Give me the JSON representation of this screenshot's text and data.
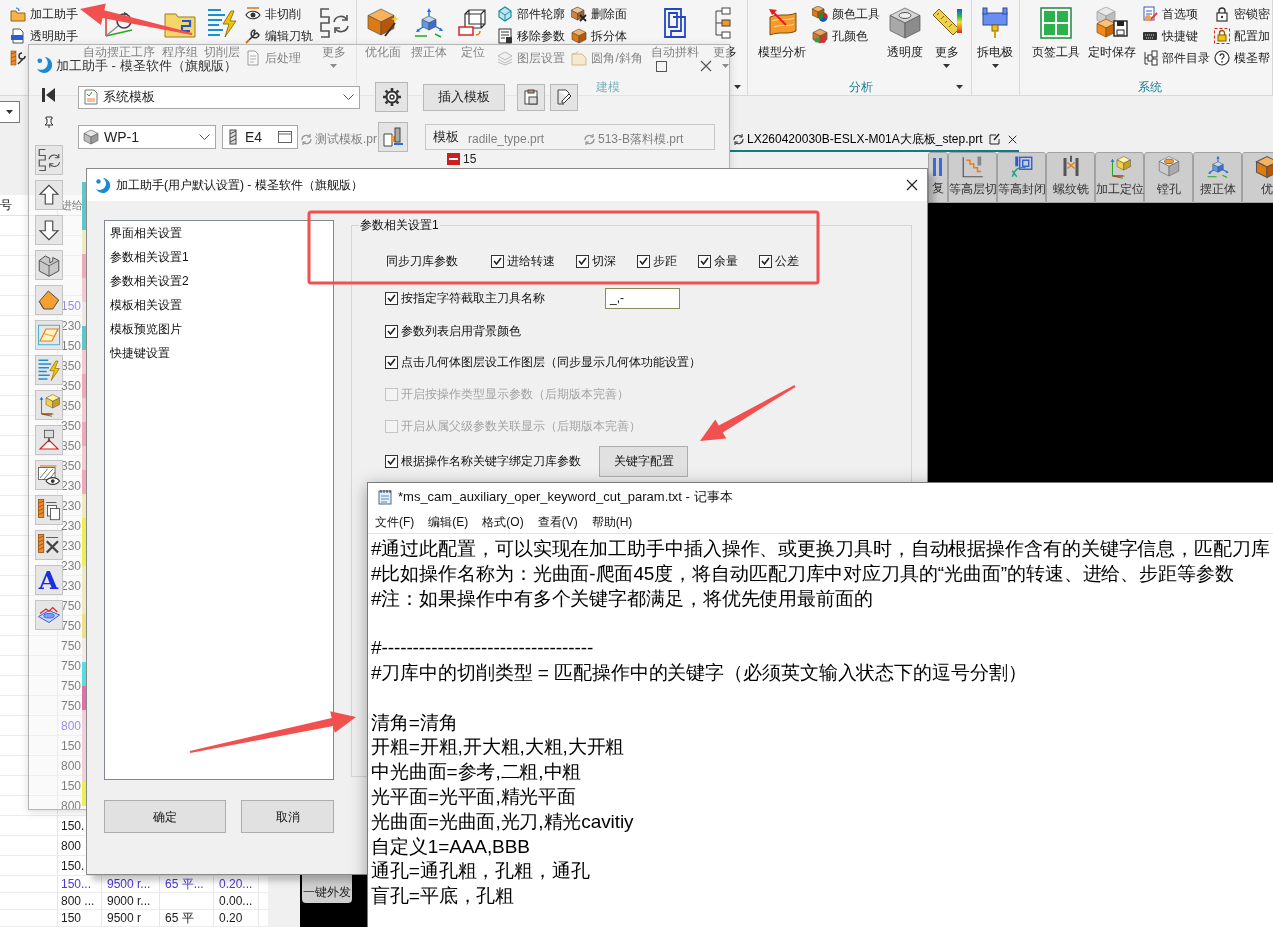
{
  "ribbon": {
    "groups": [
      {
        "launcher": false,
        "columns": [
          {
            "kind": "stack",
            "items": [
              {
                "kind": "labeled",
                "label": "加工助手"
              },
              {
                "kind": "labeled",
                "label": "透明助手"
              },
              {
                "kind": "icon"
              }
            ]
          },
          {
            "kind": "large",
            "label": "自动摆正工序",
            "caret": false
          },
          {
            "kind": "large",
            "label": "程序组",
            "caret": false
          },
          {
            "kind": "large",
            "label": "切削层",
            "caret": false
          },
          {
            "kind": "stack",
            "items": [
              {
                "kind": "labeled",
                "label": "非切削"
              },
              {
                "kind": "labeled",
                "label": "编辑刀轨"
              },
              {
                "kind": "labeled",
                "label": "后处理"
              }
            ]
          },
          {
            "kind": "large",
            "label": "更多",
            "caret": true
          }
        ]
      },
      {
        "label": "建模",
        "launcher": true,
        "columns": [
          {
            "kind": "large",
            "label": "优化面",
            "caret": false
          },
          {
            "kind": "large",
            "label": "摆正体",
            "caret": false
          },
          {
            "kind": "large",
            "label": "定位",
            "caret": false
          },
          {
            "kind": "stack",
            "items": [
              {
                "kind": "labeled",
                "label": "部件轮廓"
              },
              {
                "kind": "labeled",
                "label": "移除参数"
              },
              {
                "kind": "labeled",
                "label": "图层设置"
              }
            ]
          },
          {
            "kind": "stack",
            "items": [
              {
                "kind": "labeled",
                "label": "删除面"
              },
              {
                "kind": "labeled",
                "label": "拆分体"
              },
              {
                "kind": "labeled",
                "label": "圆角/斜角"
              }
            ]
          },
          {
            "kind": "large",
            "label": "自动拼料",
            "caret": false
          },
          {
            "kind": "large",
            "label": "更多",
            "caret": true
          }
        ]
      },
      {
        "label": "分析",
        "launcher": true,
        "columns": [
          {
            "kind": "large",
            "label": "模型分析",
            "caret": false
          },
          {
            "kind": "stack",
            "items": [
              {
                "kind": "labeled",
                "label": "颜色工具"
              },
              {
                "kind": "labeled",
                "label": "孔颜色"
              }
            ]
          },
          {
            "kind": "large",
            "label": "透明度",
            "caret": false
          },
          {
            "kind": "large",
            "label": "更多",
            "caret": true
          }
        ]
      },
      {
        "launcher": false,
        "columns": [
          {
            "kind": "large",
            "label": "拆电极",
            "caret": true
          }
        ]
      },
      {
        "label": "系统",
        "launcher": false,
        "columns": [
          {
            "kind": "large",
            "label": "页签工具",
            "caret": false
          },
          {
            "kind": "large",
            "label": "定时保存",
            "caret": false
          },
          {
            "kind": "stack",
            "items": [
              {
                "kind": "labeled",
                "label": "首选项"
              },
              {
                "kind": "labeled",
                "label": "快捷键"
              },
              {
                "kind": "labeled",
                "label": "部件目录"
              }
            ]
          },
          {
            "kind": "stack",
            "items": [
              {
                "kind": "labeled",
                "label": "密锁密"
              },
              {
                "kind": "labeled",
                "label": "配置加"
              },
              {
                "kind": "labeled",
                "label": "模圣帮"
              }
            ]
          }
        ]
      }
    ]
  },
  "part_tabs": [
    {
      "label": "测试模板.pr",
      "selected": false
    },
    {
      "label": "radile_type.prt",
      "selected": false
    },
    {
      "label": "513-B落料模.prt",
      "selected": false
    },
    {
      "label": "LX260420030B-ESLX-M01A大底板_step.prt",
      "selected": true
    }
  ],
  "operation_toolbar": [
    {
      "label": "复"
    },
    {
      "label": "等高层切"
    },
    {
      "label": "等高封闭"
    },
    {
      "label": "螺纹铣"
    },
    {
      "label": "加工定位"
    },
    {
      "label": "镗孔"
    },
    {
      "label": "摆正体"
    },
    {
      "label": "优"
    }
  ],
  "operation_table": {
    "header": {
      "column_1": "号",
      "column_2": "进给"
    },
    "rows": [
      {
        "highlighted": true,
        "column_2": "150"
      },
      {
        "highlighted": false,
        "column_2": "230"
      },
      {
        "highlighted": false,
        "column_2": "150"
      },
      {
        "highlighted": false,
        "column_2": "350"
      },
      {
        "highlighted": false,
        "column_2": "350"
      },
      {
        "highlighted": false,
        "column_2": "350"
      },
      {
        "highlighted": false,
        "column_2": "350"
      },
      {
        "highlighted": false,
        "column_2": "350"
      },
      {
        "highlighted": false,
        "column_2": "350"
      },
      {
        "highlighted": false,
        "column_2": "230"
      },
      {
        "highlighted": false,
        "column_2": "230"
      },
      {
        "highlighted": false,
        "column_2": "230"
      },
      {
        "highlighted": false,
        "column_2": "230"
      },
      {
        "highlighted": false,
        "column_2": "230"
      },
      {
        "highlighted": false,
        "column_2": "230"
      },
      {
        "highlighted": false,
        "column_2": "750"
      },
      {
        "highlighted": false,
        "column_2": "750"
      },
      {
        "highlighted": false,
        "column_2": "750"
      },
      {
        "highlighted": false,
        "column_2": "750"
      },
      {
        "highlighted": false,
        "column_2": "750"
      },
      {
        "highlighted": false,
        "column_2": "750"
      },
      {
        "highlighted": true,
        "column_2": "800"
      },
      {
        "highlighted": false,
        "column_2": "150"
      },
      {
        "highlighted": false,
        "column_2": "800"
      },
      {
        "highlighted": false,
        "column_2": "150"
      },
      {
        "highlighted": false,
        "column_2": "800"
      },
      {
        "highlighted": false,
        "column_2": "150."
      },
      {
        "highlighted": false,
        "column_2": "800"
      },
      {
        "highlighted": false,
        "column_2": "150."
      },
      {
        "highlighted": true,
        "column_2": "150...",
        "column_3": "9500 r...",
        "column_4": "65 平...",
        "column_5": "0.20..."
      },
      {
        "highlighted": false,
        "column_2": "800 ...",
        "column_3": "9000 r...",
        "column_5": "0.00..."
      },
      {
        "highlighted": false,
        "column_2": "150",
        "column_3": "9500 r",
        "column_4": "65 平",
        "column_5": "0.20"
      }
    ]
  },
  "send_button": "一键外发",
  "helper_window": {
    "title": "加工助手 - 模圣软件（旗舰版）",
    "template_select": "系统模板",
    "insert_button": "插入模板",
    "workpiece_select": "WP-1",
    "tool_field": "E4",
    "template_header": "模板",
    "template_items": [
      {
        "label": "15"
      }
    ],
    "side_tools": [
      {
        "kind": "icon"
      },
      {
        "kind": "icon"
      },
      {
        "kind": "icon"
      },
      {
        "kind": "icon"
      },
      {
        "kind": "icon"
      },
      {
        "kind": "icon"
      },
      {
        "kind": "icon"
      },
      {
        "kind": "icon"
      },
      {
        "kind": "icon"
      },
      {
        "kind": "icon"
      },
      {
        "kind": "icon"
      },
      {
        "kind": "icon"
      },
      {
        "kind": "glyph",
        "glyph": "A"
      },
      {
        "kind": "icon"
      }
    ],
    "row_colors": [
      {
        "color": "#5cc9c9"
      },
      {
        "color": "#5cc9c9"
      },
      {
        "color": "#efe9c4"
      },
      {
        "color": "#eeaab6"
      },
      {
        "color": "#f1cbd2"
      },
      {
        "color": "#efe6e6"
      },
      {
        "color": "#5cc9c9"
      },
      {
        "color": "#f1cbd2"
      },
      {
        "color": "#eeaab6"
      },
      {
        "color": "#f1cbd2"
      },
      {
        "color": "#eeaab6"
      },
      {
        "color": "#f1cbd2"
      },
      {
        "color": "#eeaab6"
      },
      {
        "color": "#efe9c4"
      },
      {
        "color": "#eeee55"
      },
      {
        "color": "#eeee55"
      },
      {
        "color": "#efe9c4"
      },
      {
        "color": "#efe9c4"
      },
      {
        "color": "#ebe28a"
      },
      {
        "color": "#efecea"
      },
      {
        "color": "#55e0e0"
      },
      {
        "color": "#e070a8"
      },
      {
        "color": "#f1d0dc"
      },
      {
        "color": "#f1d0dc"
      },
      {
        "color": "#f1d0dc"
      },
      {
        "color": "#eeee55"
      }
    ]
  },
  "settings_dialog": {
    "title": "加工助手(用户默认设置) - 模圣软件（旗舰版）",
    "nav": [
      {
        "label": "界面相关设置",
        "selected": false
      },
      {
        "label": "参数相关设置1",
        "selected": false
      },
      {
        "label": "参数相关设置2",
        "selected": false
      },
      {
        "label": "模板相关设置",
        "selected": false
      },
      {
        "label": "模板预览图片",
        "selected": false
      },
      {
        "label": "快捷键设置",
        "selected": false
      }
    ],
    "group_title": "参数相关设置1",
    "sync_label": "同步刀库参数",
    "sync_options": [
      {
        "label": "进给转速",
        "checked": true
      },
      {
        "label": "切深",
        "checked": true
      },
      {
        "label": "步距",
        "checked": true
      },
      {
        "label": "余量",
        "checked": true
      },
      {
        "label": "公差",
        "checked": true
      }
    ],
    "options": [
      {
        "label": "按指定字符截取主刀具名称",
        "checked": true,
        "disabled": false,
        "field": "_,-"
      },
      {
        "label": "参数列表启用背景颜色",
        "checked": true,
        "disabled": false
      },
      {
        "label": "点击几何体图层设工作图层（同步显示几何体功能设置）",
        "checked": true,
        "disabled": false
      },
      {
        "label": "开启按操作类型显示参数（后期版本完善）",
        "checked": false,
        "disabled": true
      },
      {
        "label": "开启从属父级参数关联显示（后期版本完善）",
        "checked": false,
        "disabled": true
      },
      {
        "label": "根据操作名称关键字绑定刀库参数",
        "checked": true,
        "disabled": false,
        "button": "关键字配置"
      }
    ],
    "buttons": [
      "确定",
      "取消"
    ]
  },
  "notepad": {
    "title": "*ms_cam_auxiliary_oper_keyword_cut_param.txt - 记事本",
    "menu": [
      "文件(F)",
      "编辑(E)",
      "格式(O)",
      "查看(V)",
      "帮助(H)"
    ],
    "paragraphs": [
      [
        "#通过此配置，可以实现在加工助手中插入操作、或更换刀具时，自动根据操作含有的关键字信息，匹配刀库",
        "#比如操作名称为：光曲面-爬面45度，将自动匹配刀库中对应刀具的“光曲面”的转速、进给、步距等参数",
        "#注：如果操作中有多个关键字都满足，将优先使用最前面的"
      ],
      [
        "#----------------------------------",
        "#刀库中的切削类型 = 匹配操作中的关键字（必须英文输入状态下的逗号分割）"
      ],
      [
        "清角=清角",
        "开粗=开粗,开大粗,大粗,大开粗",
        "中光曲面=参考,二粗,中粗",
        "光平面=光平面,精光平面",
        "光曲面=光曲面,光刀,精光cavitiy",
        "自定义1=AAA,BBB",
        "通孔=通孔粗，孔粗，通孔",
        "盲孔=平底，孔粗"
      ]
    ]
  },
  "annotations": [
    {
      "kind": "arrow"
    },
    {
      "kind": "frame"
    },
    {
      "kind": "arrow"
    },
    {
      "kind": "arrow"
    }
  ]
}
